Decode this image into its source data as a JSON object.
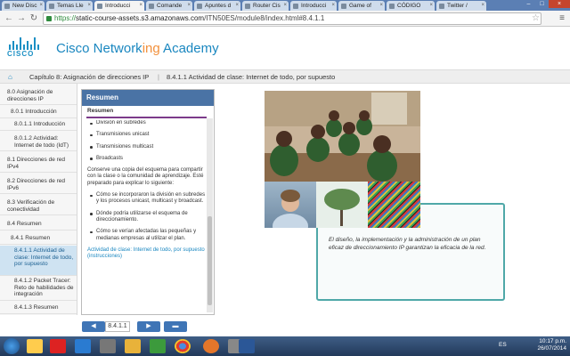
{
  "browser": {
    "tabs": [
      {
        "label": "New Disc",
        "active": false
      },
      {
        "label": "Temas Lle",
        "active": false
      },
      {
        "label": "Introducci",
        "active": true
      },
      {
        "label": "Comande",
        "active": false
      },
      {
        "label": "Apuntes d",
        "active": false
      },
      {
        "label": "Router Cis",
        "active": false
      },
      {
        "label": "Introducci",
        "active": false
      },
      {
        "label": "Game of",
        "active": false
      },
      {
        "label": "CÓDIGO",
        "active": false
      },
      {
        "label": "Twitter /",
        "active": false
      }
    ],
    "url_scheme": "https://",
    "url_host": "static-course-assets.s3.amazonaws.com",
    "url_path": "/ITN50ES/module8/index.html#8.4.1.1"
  },
  "header": {
    "logo_word": "CISCO",
    "brand_main": "Cisco Network",
    "brand_accent": "ing",
    "brand_end": " Academy"
  },
  "breadcrumb": {
    "chapter": "Capítulo 8: Asignación de direcciones IP",
    "separator": "|",
    "current": "8.4.1.1 Actividad de clase: Internet de todo, por supuesto"
  },
  "sidebar": {
    "items": [
      {
        "label": "8.0 Asignación de direcciones IP",
        "indent": 8,
        "active": false
      },
      {
        "label": "8.0.1 Introducción",
        "indent": 12,
        "active": false
      },
      {
        "label": "8.0.1.1 Introducción",
        "indent": 16,
        "active": false
      },
      {
        "label": "8.0.1.2 Actividad: Internet de todo (IdT)",
        "indent": 16,
        "active": false
      },
      {
        "label": "8.1 Direcciones de red IPv4",
        "indent": 8,
        "active": false
      },
      {
        "label": "8.2 Direcciones de red IPv6",
        "indent": 8,
        "active": false
      },
      {
        "label": "8.3 Verificación de conectividad",
        "indent": 8,
        "active": false
      },
      {
        "label": "8.4 Resumen",
        "indent": 8,
        "active": false
      },
      {
        "label": "8.4.1 Resumen",
        "indent": 12,
        "active": false
      },
      {
        "label": "8.4.1.1 Actividad de clase: Internet de todo, por supuesto",
        "indent": 16,
        "active": true
      },
      {
        "label": "8.4.1.2 Packet Tracer: Reto de habilidades de integración",
        "indent": 16,
        "active": false
      },
      {
        "label": "8.4.1.3 Resumen",
        "indent": 16,
        "active": false
      }
    ]
  },
  "resumen": {
    "title": "Resumen",
    "subtitle": "Resumen",
    "bullets1": [
      "División en subredes",
      "Transmisiones unicast",
      "Transmisiones multicast",
      "Broadcasts"
    ],
    "paragraph": "Conserve una copia del esquema para compartir con la clase o la comunidad de aprendizaje. Esté preparado para explicar lo siguiente:",
    "bullets2": [
      "Cómo se incorporaron la división en subredes y los procesos unicast, multicast y broadcast.",
      "Dónde podría utilizarse el esquema de direccionamiento.",
      "Cómo se verían afectadas las pequeñas y medianas empresas al utilizar el plan."
    ],
    "link": "Actividad de clase: Internet de todo, por supuesto (instrucciones)"
  },
  "caption": {
    "text": "El diseño, la implementación y la administración de un plan eficaz de direccionamiento IP garantizan la eficacia de la red."
  },
  "bottom_nav": {
    "prev_label": "◀",
    "page": "8.4.1.1",
    "next_label": "▶",
    "menu_label": "▬"
  },
  "taskbar": {
    "lang": "ES",
    "time": "10:17 p.m.",
    "date": "26/07/2014"
  },
  "colors": {
    "brand_blue": "#1a87c0",
    "brand_orange": "#f2913d",
    "panel_header": "#4a73a5",
    "accent_purple": "#7c3b8a",
    "caption_border": "#4fa8a8"
  }
}
